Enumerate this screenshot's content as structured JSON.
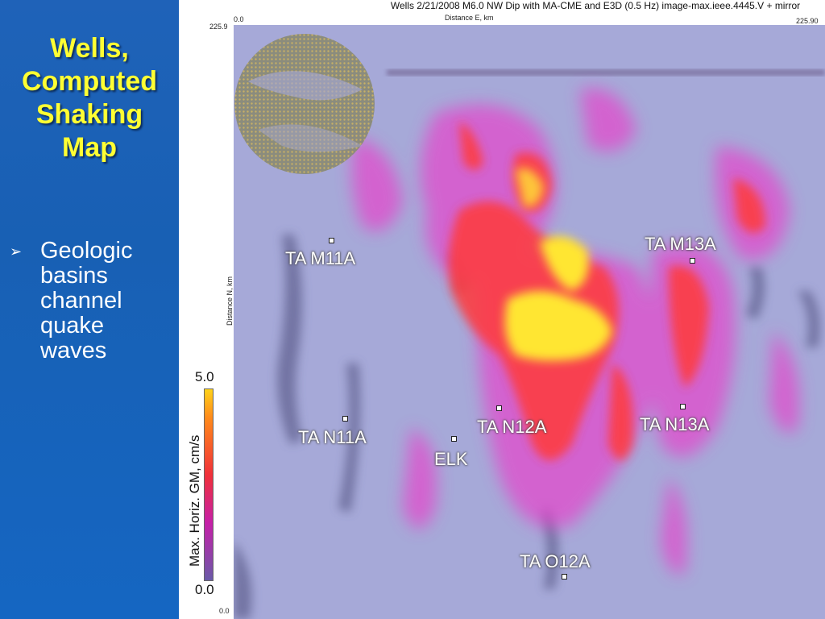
{
  "slide": {
    "title": "Wells,\nComputed\nShaking\nMap",
    "bullet_glyph": "➢",
    "bullet_text": "Geologic\nbasins\nchannel\nquake\nwaves"
  },
  "figure": {
    "title": "Wells 2/21/2008 M6.0 NW Dip with MA-CME and E3D (0.5 Hz) image-max.ieee.4445.V + mirror",
    "x_axis_label": "Distance E, km",
    "y_axis_label": "Distance N, km",
    "x_tick_left": "0.0",
    "x_tick_right": "225.90",
    "y_tick_top": "225.9",
    "y_tick_bottom": "0.0",
    "colorbar": {
      "title": "Max. Horiz. GM, cm/s",
      "max": "5.0",
      "min": "0.0"
    },
    "stations": [
      {
        "id": "m11a",
        "name": "TA M11A"
      },
      {
        "id": "m13a",
        "name": "TA M13A"
      },
      {
        "id": "n11a",
        "name": "TA N11A"
      },
      {
        "id": "elk",
        "name": "ELK"
      },
      {
        "id": "n12a",
        "name": "TA N12A"
      },
      {
        "id": "n13a",
        "name": "TA N13A"
      },
      {
        "id": "o12a",
        "name": "TA O12A"
      }
    ]
  },
  "colors": {
    "slide_bg": "#1a5fb0",
    "title_yellow": "#ffff33",
    "map_bg": "#a7a9d6",
    "hot_yellow": "#ffe633",
    "hot_red": "#f0303a",
    "magenta": "#e040c8"
  }
}
